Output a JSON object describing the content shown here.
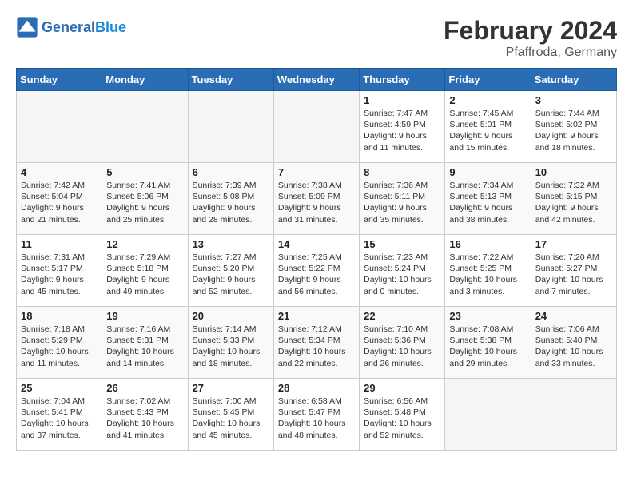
{
  "header": {
    "logo_general": "General",
    "logo_blue": "Blue",
    "month_year": "February 2024",
    "location": "Pfaffroda, Germany"
  },
  "weekdays": [
    "Sunday",
    "Monday",
    "Tuesday",
    "Wednesday",
    "Thursday",
    "Friday",
    "Saturday"
  ],
  "weeks": [
    [
      {
        "day": "",
        "info": ""
      },
      {
        "day": "",
        "info": ""
      },
      {
        "day": "",
        "info": ""
      },
      {
        "day": "",
        "info": ""
      },
      {
        "day": "1",
        "info": "Sunrise: 7:47 AM\nSunset: 4:59 PM\nDaylight: 9 hours\nand 11 minutes."
      },
      {
        "day": "2",
        "info": "Sunrise: 7:45 AM\nSunset: 5:01 PM\nDaylight: 9 hours\nand 15 minutes."
      },
      {
        "day": "3",
        "info": "Sunrise: 7:44 AM\nSunset: 5:02 PM\nDaylight: 9 hours\nand 18 minutes."
      }
    ],
    [
      {
        "day": "4",
        "info": "Sunrise: 7:42 AM\nSunset: 5:04 PM\nDaylight: 9 hours\nand 21 minutes."
      },
      {
        "day": "5",
        "info": "Sunrise: 7:41 AM\nSunset: 5:06 PM\nDaylight: 9 hours\nand 25 minutes."
      },
      {
        "day": "6",
        "info": "Sunrise: 7:39 AM\nSunset: 5:08 PM\nDaylight: 9 hours\nand 28 minutes."
      },
      {
        "day": "7",
        "info": "Sunrise: 7:38 AM\nSunset: 5:09 PM\nDaylight: 9 hours\nand 31 minutes."
      },
      {
        "day": "8",
        "info": "Sunrise: 7:36 AM\nSunset: 5:11 PM\nDaylight: 9 hours\nand 35 minutes."
      },
      {
        "day": "9",
        "info": "Sunrise: 7:34 AM\nSunset: 5:13 PM\nDaylight: 9 hours\nand 38 minutes."
      },
      {
        "day": "10",
        "info": "Sunrise: 7:32 AM\nSunset: 5:15 PM\nDaylight: 9 hours\nand 42 minutes."
      }
    ],
    [
      {
        "day": "11",
        "info": "Sunrise: 7:31 AM\nSunset: 5:17 PM\nDaylight: 9 hours\nand 45 minutes."
      },
      {
        "day": "12",
        "info": "Sunrise: 7:29 AM\nSunset: 5:18 PM\nDaylight: 9 hours\nand 49 minutes."
      },
      {
        "day": "13",
        "info": "Sunrise: 7:27 AM\nSunset: 5:20 PM\nDaylight: 9 hours\nand 52 minutes."
      },
      {
        "day": "14",
        "info": "Sunrise: 7:25 AM\nSunset: 5:22 PM\nDaylight: 9 hours\nand 56 minutes."
      },
      {
        "day": "15",
        "info": "Sunrise: 7:23 AM\nSunset: 5:24 PM\nDaylight: 10 hours\nand 0 minutes."
      },
      {
        "day": "16",
        "info": "Sunrise: 7:22 AM\nSunset: 5:25 PM\nDaylight: 10 hours\nand 3 minutes."
      },
      {
        "day": "17",
        "info": "Sunrise: 7:20 AM\nSunset: 5:27 PM\nDaylight: 10 hours\nand 7 minutes."
      }
    ],
    [
      {
        "day": "18",
        "info": "Sunrise: 7:18 AM\nSunset: 5:29 PM\nDaylight: 10 hours\nand 11 minutes."
      },
      {
        "day": "19",
        "info": "Sunrise: 7:16 AM\nSunset: 5:31 PM\nDaylight: 10 hours\nand 14 minutes."
      },
      {
        "day": "20",
        "info": "Sunrise: 7:14 AM\nSunset: 5:33 PM\nDaylight: 10 hours\nand 18 minutes."
      },
      {
        "day": "21",
        "info": "Sunrise: 7:12 AM\nSunset: 5:34 PM\nDaylight: 10 hours\nand 22 minutes."
      },
      {
        "day": "22",
        "info": "Sunrise: 7:10 AM\nSunset: 5:36 PM\nDaylight: 10 hours\nand 26 minutes."
      },
      {
        "day": "23",
        "info": "Sunrise: 7:08 AM\nSunset: 5:38 PM\nDaylight: 10 hours\nand 29 minutes."
      },
      {
        "day": "24",
        "info": "Sunrise: 7:06 AM\nSunset: 5:40 PM\nDaylight: 10 hours\nand 33 minutes."
      }
    ],
    [
      {
        "day": "25",
        "info": "Sunrise: 7:04 AM\nSunset: 5:41 PM\nDaylight: 10 hours\nand 37 minutes."
      },
      {
        "day": "26",
        "info": "Sunrise: 7:02 AM\nSunset: 5:43 PM\nDaylight: 10 hours\nand 41 minutes."
      },
      {
        "day": "27",
        "info": "Sunrise: 7:00 AM\nSunset: 5:45 PM\nDaylight: 10 hours\nand 45 minutes."
      },
      {
        "day": "28",
        "info": "Sunrise: 6:58 AM\nSunset: 5:47 PM\nDaylight: 10 hours\nand 48 minutes."
      },
      {
        "day": "29",
        "info": "Sunrise: 6:56 AM\nSunset: 5:48 PM\nDaylight: 10 hours\nand 52 minutes."
      },
      {
        "day": "",
        "info": ""
      },
      {
        "day": "",
        "info": ""
      }
    ]
  ]
}
